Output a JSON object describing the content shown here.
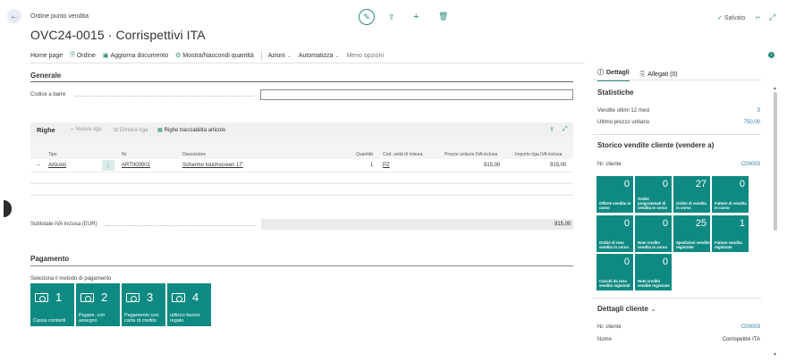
{
  "header": {
    "breadcrumb": "Ordine punto vendita",
    "title": "OVC24-0015 · Corrispettivi ITA",
    "saved": "Salvato"
  },
  "toolbar": {
    "items": [
      "Home page",
      "Ordine",
      "Aggiorna documento",
      "Mostra/Nascondi quantità"
    ],
    "actions": "Azioni",
    "automate": "Automatizza",
    "less": "Meno opzioni"
  },
  "general": {
    "title": "Generale",
    "barcode_label": "Codice a barre",
    "barcode_value": ""
  },
  "lines": {
    "title": "Righe",
    "new_line": "Nuova riga",
    "delete_line": "Elimina riga",
    "tracking": "Righe tracciabilità articolo",
    "columns": [
      "Tipo",
      "Nr.",
      "Descrizione",
      "Quantità",
      "Cod. unità di misura",
      "Prezzo unitario IVA inclusa",
      "Importo riga IVA inclusa"
    ],
    "rows": [
      {
        "type": "Articolo",
        "no": "ART000001",
        "description": "Schermo touchscreen 17'",
        "qty": "1",
        "uom": "PZ",
        "unit_price": "915,00",
        "amount": "915,00"
      }
    ]
  },
  "subtotal": {
    "label": "Subtotale IVA inclusa (EUR)",
    "value": "915,00"
  },
  "payment": {
    "title": "Pagamento",
    "prompt": "Seleziona il metodo di pagamento",
    "methods": [
      {
        "num": "1",
        "label": "Cassa contanti"
      },
      {
        "num": "2",
        "label": "Pagam. con assegno"
      },
      {
        "num": "3",
        "label": "Pagamento con carta di credito"
      },
      {
        "num": "4",
        "label": "utilizzo buono regalo"
      }
    ]
  },
  "factbox": {
    "tab_details": "Dettagli",
    "tab_attachments": "Allegati (0)",
    "stats": {
      "title": "Statistiche",
      "sales12_label": "Vendite ultimi 12 mesi",
      "sales12_value": "3",
      "last_price_label": "Ultimo prezzo unitario",
      "last_price_value": "750,00"
    },
    "history": {
      "title": "Storico vendite cliente (vendere a)",
      "customer_label": "Nr. cliente",
      "customer_value": "C00003",
      "tiles": [
        {
          "n": "0",
          "label": "Offerte vendita in corso"
        },
        {
          "n": "0",
          "label": "Ordini programmati di vendita in corso"
        },
        {
          "n": "27",
          "label": "Ordini di vendita in corso"
        },
        {
          "n": "0",
          "label": "Fatture di vendita in corso"
        },
        {
          "n": "0",
          "label": "Ordini di reso vendita in corso"
        },
        {
          "n": "0",
          "label": "Note credito vendita in corso"
        },
        {
          "n": "25",
          "label": "Spedizioni vendite registrate"
        },
        {
          "n": "1",
          "label": "Fatture vendita registrate"
        },
        {
          "n": "0",
          "label": "Carichi da reso vendite registrati"
        },
        {
          "n": "0",
          "label": "Note credito vendite registrate"
        }
      ]
    },
    "customer": {
      "title": "Dettagli cliente",
      "no_label": "Nr. cliente",
      "no_value": "C00003",
      "name_label": "Nome",
      "name_value": "Corrispettivi ITA"
    }
  }
}
